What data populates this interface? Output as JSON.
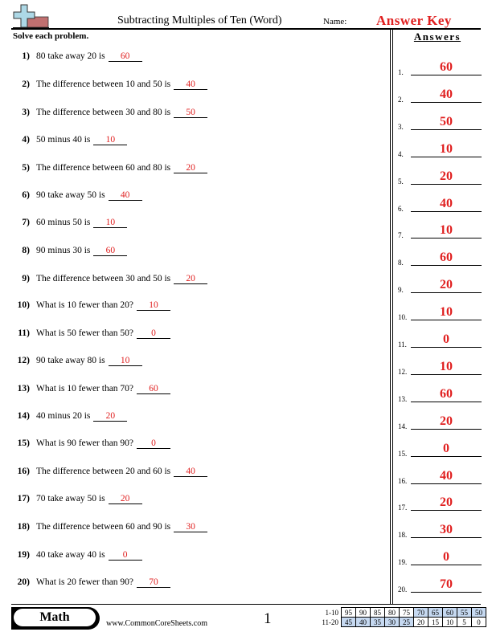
{
  "header": {
    "title": "Subtracting Multiples of Ten (Word)",
    "name_label": "Name:",
    "answer_key": "Answer Key",
    "logo_icon": "plus-minus-logo-icon"
  },
  "instructions": "Solve each problem.",
  "answers_heading": "Answers",
  "questions": [
    {
      "num": "1)",
      "text": "80 take away 20 is",
      "answer": "60"
    },
    {
      "num": "2)",
      "text": "The difference between 10 and 50 is",
      "answer": "40"
    },
    {
      "num": "3)",
      "text": "The difference between 30 and 80 is",
      "answer": "50"
    },
    {
      "num": "4)",
      "text": "50 minus 40 is",
      "answer": "10"
    },
    {
      "num": "5)",
      "text": "The difference between 60 and 80 is",
      "answer": "20"
    },
    {
      "num": "6)",
      "text": "90 take away 50 is",
      "answer": "40"
    },
    {
      "num": "7)",
      "text": "60 minus 50 is",
      "answer": "10"
    },
    {
      "num": "8)",
      "text": "90 minus 30 is",
      "answer": "60"
    },
    {
      "num": "9)",
      "text": "The difference between 30 and 50 is",
      "answer": "20"
    },
    {
      "num": "10)",
      "text": "What is 10 fewer than 20?",
      "answer": "10"
    },
    {
      "num": "11)",
      "text": "What is 50 fewer than 50?",
      "answer": "0"
    },
    {
      "num": "12)",
      "text": "90 take away 80 is",
      "answer": "10"
    },
    {
      "num": "13)",
      "text": "What is 10 fewer than 70?",
      "answer": "60"
    },
    {
      "num": "14)",
      "text": "40 minus 20 is",
      "answer": "20"
    },
    {
      "num": "15)",
      "text": "What is 90 fewer than 90?",
      "answer": "0"
    },
    {
      "num": "16)",
      "text": "The difference between 20 and 60 is",
      "answer": "40"
    },
    {
      "num": "17)",
      "text": "70 take away 50 is",
      "answer": "20"
    },
    {
      "num": "18)",
      "text": "The difference between 60 and 90 is",
      "answer": "30"
    },
    {
      "num": "19)",
      "text": "40 take away 40 is",
      "answer": "0"
    },
    {
      "num": "20)",
      "text": "What is 20 fewer than 90?",
      "answer": "70"
    }
  ],
  "answer_key_list": [
    {
      "num": "1.",
      "answer": "60"
    },
    {
      "num": "2.",
      "answer": "40"
    },
    {
      "num": "3.",
      "answer": "50"
    },
    {
      "num": "4.",
      "answer": "10"
    },
    {
      "num": "5.",
      "answer": "20"
    },
    {
      "num": "6.",
      "answer": "40"
    },
    {
      "num": "7.",
      "answer": "10"
    },
    {
      "num": "8.",
      "answer": "60"
    },
    {
      "num": "9.",
      "answer": "20"
    },
    {
      "num": "10.",
      "answer": "10"
    },
    {
      "num": "11.",
      "answer": "0"
    },
    {
      "num": "12.",
      "answer": "10"
    },
    {
      "num": "13.",
      "answer": "60"
    },
    {
      "num": "14.",
      "answer": "20"
    },
    {
      "num": "15.",
      "answer": "0"
    },
    {
      "num": "16.",
      "answer": "40"
    },
    {
      "num": "17.",
      "answer": "20"
    },
    {
      "num": "18.",
      "answer": "30"
    },
    {
      "num": "19.",
      "answer": "0"
    },
    {
      "num": "20.",
      "answer": "70"
    }
  ],
  "footer": {
    "subject": "Math",
    "website": "www.CommonCoreSheets.com",
    "page_number": "1",
    "score_table": {
      "rows": [
        {
          "label": "1-10",
          "values": [
            "95",
            "90",
            "85",
            "80",
            "75",
            "70",
            "65",
            "60",
            "55",
            "50"
          ],
          "highlighted": [
            false,
            false,
            false,
            false,
            false,
            true,
            true,
            true,
            true,
            true
          ]
        },
        {
          "label": "11-20",
          "values": [
            "45",
            "40",
            "35",
            "30",
            "25",
            "20",
            "15",
            "10",
            "5",
            "0"
          ],
          "highlighted": [
            true,
            true,
            true,
            true,
            true,
            false,
            false,
            false,
            false,
            false
          ]
        }
      ],
      "highlight_color": "#c6d9f1"
    }
  },
  "colors": {
    "answer_red": "#e02020"
  }
}
